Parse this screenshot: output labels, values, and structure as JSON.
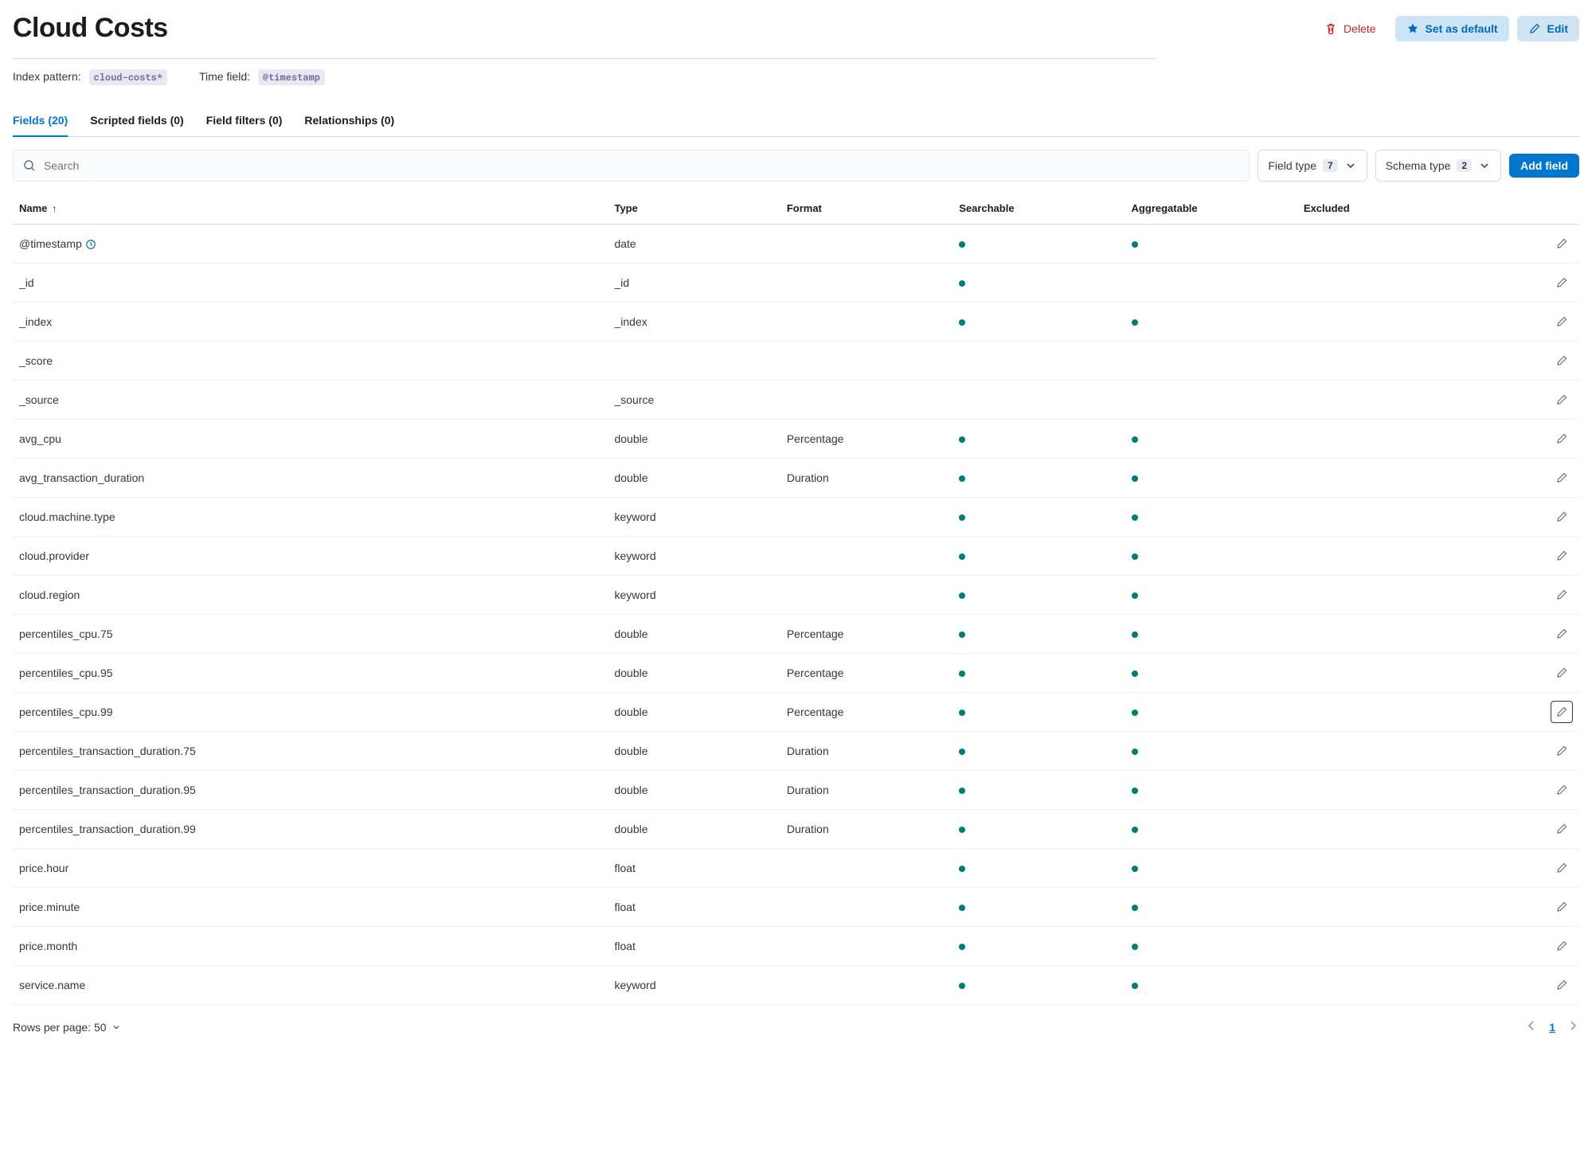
{
  "title": "Cloud Costs",
  "actions": {
    "delete": "Delete",
    "set_default": "Set as default",
    "edit": "Edit"
  },
  "meta": {
    "index_label": "Index pattern:",
    "index_value": "cloud-costs*",
    "time_label": "Time field:",
    "time_value": "@timestamp"
  },
  "tabs": [
    {
      "label": "Fields (20)",
      "active": true
    },
    {
      "label": "Scripted fields (0)",
      "active": false
    },
    {
      "label": "Field filters (0)",
      "active": false
    },
    {
      "label": "Relationships (0)",
      "active": false
    }
  ],
  "search_placeholder": "Search",
  "filters": {
    "field_type_label": "Field type",
    "field_type_count": "7",
    "schema_type_label": "Schema type",
    "schema_type_count": "2"
  },
  "add_field": "Add field",
  "columns": {
    "name": "Name",
    "type": "Type",
    "format": "Format",
    "searchable": "Searchable",
    "aggregatable": "Aggregatable",
    "excluded": "Excluded"
  },
  "rows": [
    {
      "name": "@timestamp",
      "type": "date",
      "format": "",
      "searchable": true,
      "aggregatable": true,
      "clock": true
    },
    {
      "name": "_id",
      "type": "_id",
      "format": "",
      "searchable": true,
      "aggregatable": false
    },
    {
      "name": "_index",
      "type": "_index",
      "format": "",
      "searchable": true,
      "aggregatable": true
    },
    {
      "name": "_score",
      "type": "",
      "format": "",
      "searchable": false,
      "aggregatable": false
    },
    {
      "name": "_source",
      "type": "_source",
      "format": "",
      "searchable": false,
      "aggregatable": false
    },
    {
      "name": "avg_cpu",
      "type": "double",
      "format": "Percentage",
      "searchable": true,
      "aggregatable": true
    },
    {
      "name": "avg_transaction_duration",
      "type": "double",
      "format": "Duration",
      "searchable": true,
      "aggregatable": true
    },
    {
      "name": "cloud.machine.type",
      "type": "keyword",
      "format": "",
      "searchable": true,
      "aggregatable": true
    },
    {
      "name": "cloud.provider",
      "type": "keyword",
      "format": "",
      "searchable": true,
      "aggregatable": true
    },
    {
      "name": "cloud.region",
      "type": "keyword",
      "format": "",
      "searchable": true,
      "aggregatable": true
    },
    {
      "name": "percentiles_cpu.75",
      "type": "double",
      "format": "Percentage",
      "searchable": true,
      "aggregatable": true
    },
    {
      "name": "percentiles_cpu.95",
      "type": "double",
      "format": "Percentage",
      "searchable": true,
      "aggregatable": true
    },
    {
      "name": "percentiles_cpu.99",
      "type": "double",
      "format": "Percentage",
      "searchable": true,
      "aggregatable": true,
      "focused": true
    },
    {
      "name": "percentiles_transaction_duration.75",
      "type": "double",
      "format": "Duration",
      "searchable": true,
      "aggregatable": true
    },
    {
      "name": "percentiles_transaction_duration.95",
      "type": "double",
      "format": "Duration",
      "searchable": true,
      "aggregatable": true
    },
    {
      "name": "percentiles_transaction_duration.99",
      "type": "double",
      "format": "Duration",
      "searchable": true,
      "aggregatable": true
    },
    {
      "name": "price.hour",
      "type": "float",
      "format": "",
      "searchable": true,
      "aggregatable": true
    },
    {
      "name": "price.minute",
      "type": "float",
      "format": "",
      "searchable": true,
      "aggregatable": true
    },
    {
      "name": "price.month",
      "type": "float",
      "format": "",
      "searchable": true,
      "aggregatable": true
    },
    {
      "name": "service.name",
      "type": "keyword",
      "format": "",
      "searchable": true,
      "aggregatable": true
    }
  ],
  "footer": {
    "rows_label": "Rows per page: 50",
    "page": "1"
  }
}
